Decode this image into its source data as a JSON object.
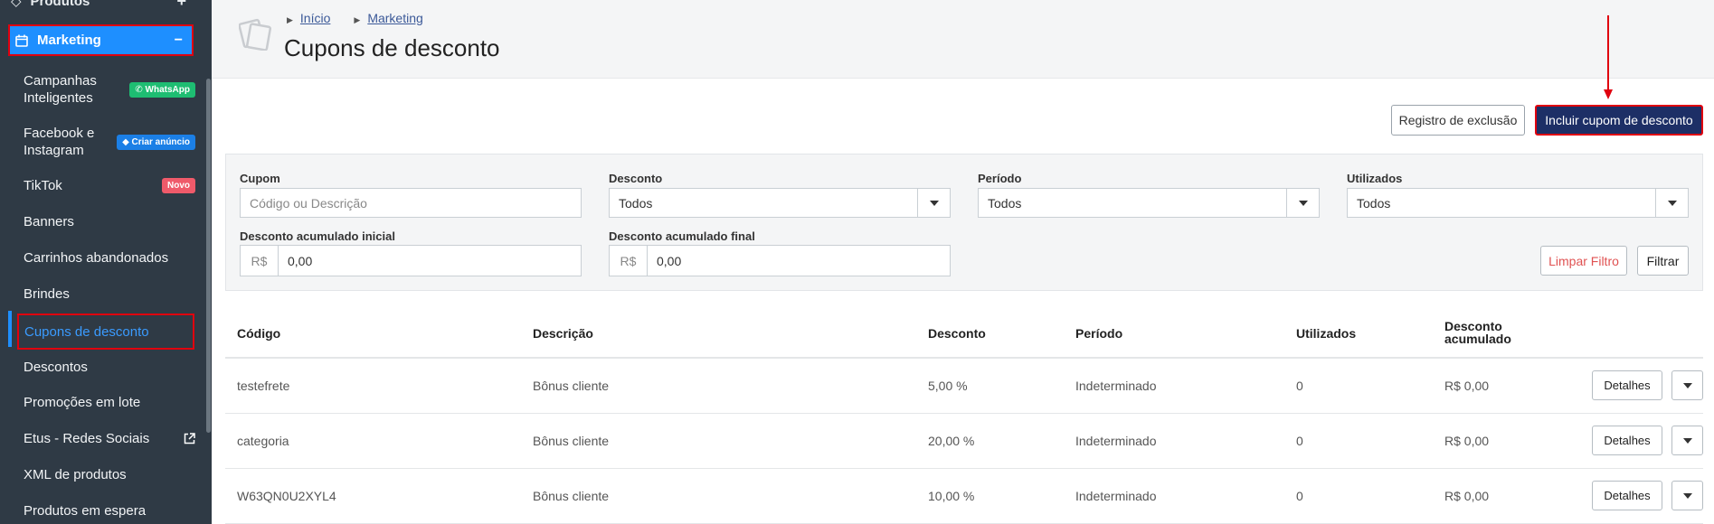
{
  "sidebar": {
    "produtos_label": "Produtos",
    "marketing_label": "Marketing",
    "items": [
      {
        "label": "Campanhas Inteligentes",
        "badge": "WhatsApp"
      },
      {
        "label": "Facebook e Instagram",
        "badge": "Criar anúncio"
      },
      {
        "label": "TikTok",
        "badge": "Novo"
      },
      {
        "label": "Banners"
      },
      {
        "label": "Carrinhos abandonados"
      },
      {
        "label": "Brindes"
      },
      {
        "label": "Cupons de desconto"
      },
      {
        "label": "Descontos"
      },
      {
        "label": "Promoções em lote"
      },
      {
        "label": "Etus - Redes Sociais"
      },
      {
        "label": "XML de produtos"
      },
      {
        "label": "Produtos em espera"
      }
    ]
  },
  "header": {
    "breadcrumb": [
      "Início",
      "Marketing"
    ],
    "title": "Cupons de desconto"
  },
  "actions": {
    "registro_label": "Registro de exclusão",
    "incluir_label": "Incluir cupom de desconto"
  },
  "filters": {
    "cupom_label": "Cupom",
    "cupom_placeholder": "Código ou Descrição",
    "desconto_label": "Desconto",
    "desconto_value": "Todos",
    "periodo_label": "Período",
    "periodo_value": "Todos",
    "utilizados_label": "Utilizados",
    "utilizados_value": "Todos",
    "acum_inicial_label": "Desconto acumulado inicial",
    "acum_final_label": "Desconto acumulado final",
    "currency": "R$",
    "acum_inicial_value": "0,00",
    "acum_final_value": "0,00",
    "limpar_label": "Limpar Filtro",
    "filtrar_label": "Filtrar"
  },
  "table": {
    "headers": [
      "Código",
      "Descrição",
      "Desconto",
      "Período",
      "Utilizados",
      "Desconto acumulado"
    ],
    "details_label": "Detalhes",
    "rows": [
      {
        "codigo": "testefrete",
        "descricao": "Bônus cliente",
        "desconto": "5,00 %",
        "periodo": "Indeterminado",
        "utilizados": "0",
        "acumulado": "R$ 0,00"
      },
      {
        "codigo": "categoria",
        "descricao": "Bônus cliente",
        "desconto": "20,00 %",
        "periodo": "Indeterminado",
        "utilizados": "0",
        "acumulado": "R$ 0,00"
      },
      {
        "codigo": "W63QN0U2XYL4",
        "descricao": "Bônus cliente",
        "desconto": "10,00 %",
        "periodo": "Indeterminado",
        "utilizados": "0",
        "acumulado": "R$ 0,00"
      }
    ]
  },
  "colors": {
    "sidebar_bg": "#2f3a45",
    "accent": "#1e8fff",
    "primary_button": "#1d2f66",
    "highlight": "#e0000e"
  }
}
